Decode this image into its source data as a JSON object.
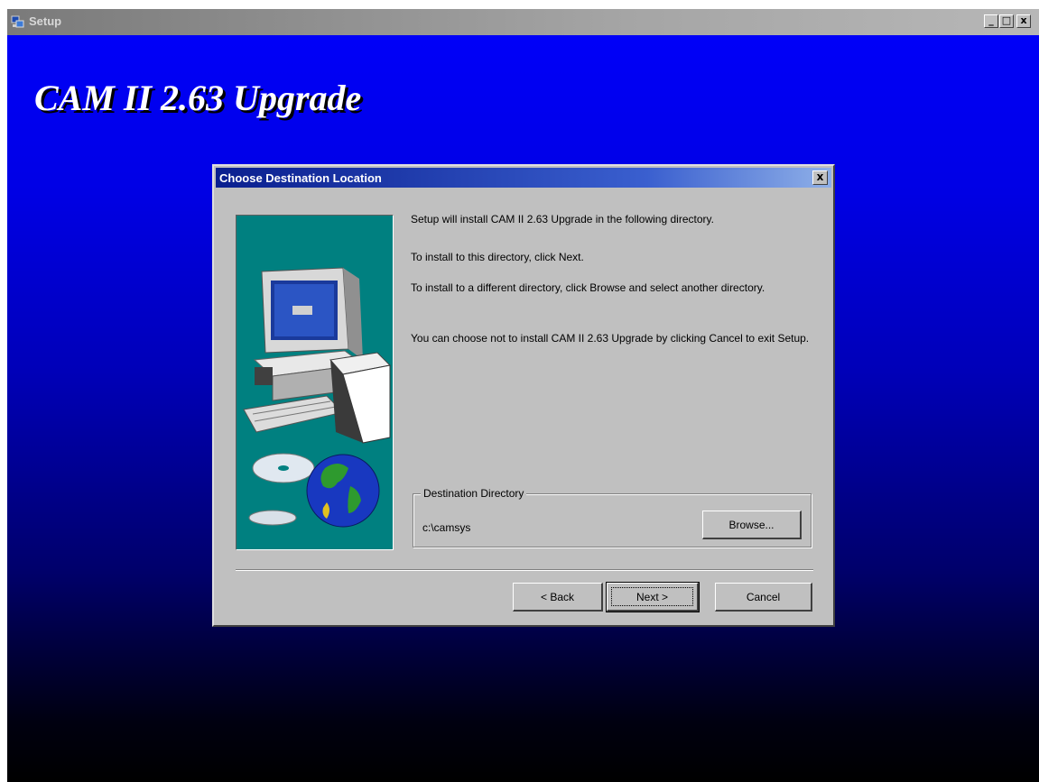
{
  "window": {
    "title": "Setup",
    "controls": {
      "minimize": "_",
      "maximize": "□",
      "close": "x"
    }
  },
  "banner": {
    "title": "CAM II 2.63 Upgrade"
  },
  "dialog": {
    "title": "Choose Destination Location",
    "close_label": "x",
    "messages": [
      "Setup will install CAM II 2.63 Upgrade in the following directory.",
      "To install to this directory, click Next.",
      "To install to a different directory, click Browse and select another directory.",
      "You can choose not to install CAM II 2.63 Upgrade by clicking Cancel to exit Setup."
    ],
    "destination": {
      "legend": "Destination Directory",
      "path": "c:\\camsys",
      "browse_label": "Browse..."
    },
    "buttons": {
      "back": "< Back",
      "next": "Next >",
      "cancel": "Cancel"
    }
  },
  "colors": {
    "desktop_top": "#0000f8",
    "desktop_bottom": "#000000",
    "dialog_face": "#c0c0c0",
    "art_bg": "#008080",
    "dialog_titlebar": "#0a1f8f"
  },
  "icons": [
    "setup-app-icon",
    "computer-illustration",
    "globe-icon",
    "cd-disc-icon"
  ]
}
